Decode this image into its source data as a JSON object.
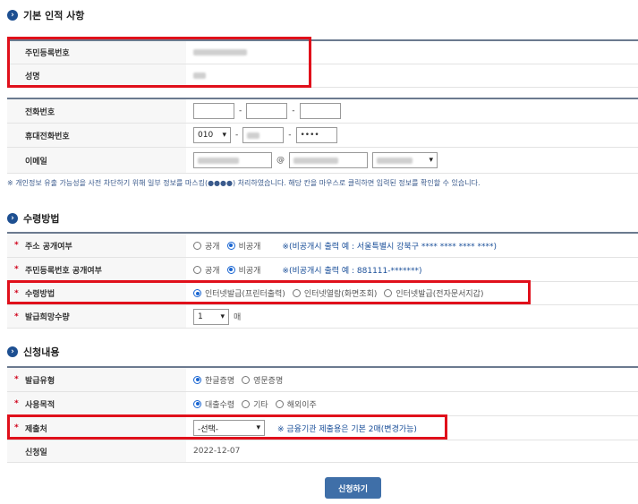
{
  "sections": {
    "basic": "기본 인적 사항",
    "receive": "수령방법",
    "apply": "신청내용"
  },
  "basic": {
    "rrn_label": "주민등록번호",
    "name_label": "성명",
    "phone_label": "전화번호",
    "mobile_label": "휴대전화번호",
    "mobile_prefix": "010",
    "mobile_last": "••••",
    "email_label": "이메일",
    "email_at": "@",
    "privacy_note": "※ 개인정보 유출 가능성을 사전 차단하기 위해 일부 정보를 마스킹(●●●●) 처리하였습니다. 해당 칸을 마우스로 클릭하면 입력된 정보를 확인할 수 있습니다."
  },
  "receive": {
    "addr_label": "주소 공개여부",
    "addr_opt_public": "공개",
    "addr_opt_private": "비공개",
    "addr_note": "※(비공개시 출력 예 : 서울특별시 강북구 **** **** **** ****)",
    "rrn_open_label": "주민등록번호 공개여부",
    "rrn_opt_public": "공개",
    "rrn_opt_private": "비공개",
    "rrn_note": "※(비공개시 출력 예 : 881111-*******)",
    "method_label": "수령방법",
    "method_opt1": "인터넷발급(프린터출력)",
    "method_opt2": "인터넷열람(화면조회)",
    "method_opt3": "인터넷발급(전자문서지갑)",
    "copies_label": "발급희망수량",
    "copies_value": "1",
    "copies_unit": "매"
  },
  "apply": {
    "type_label": "발급유형",
    "type_opt1": "한글증명",
    "type_opt2": "영문증명",
    "purpose_label": "사용목적",
    "purpose_opt1": "대출수령",
    "purpose_opt2": "기타",
    "purpose_opt3": "해외이주",
    "submit_to_label": "제출처",
    "submit_to_value": "-선택-",
    "submit_to_note": "※ 금융기관 제출용은 기본 2매(변경가능)",
    "date_label": "신청일",
    "date_value": "2022-12-07"
  },
  "submit_button": "신청하기",
  "colors": {
    "accent": "#1d4f91",
    "highlight": "#e0101b",
    "note": "#1a4f99"
  }
}
